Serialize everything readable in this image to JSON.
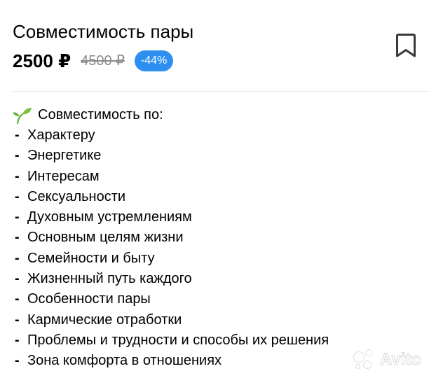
{
  "listing": {
    "title": "Совместимость пары",
    "price": "2500 ₽",
    "old_price": "4500 ₽",
    "discount": "-44%",
    "bookmark_icon": "bookmark-icon"
  },
  "description": {
    "heading_icon": "sprout-icon",
    "heading": "Совместимость по:",
    "items": [
      "Характеру",
      "Энергетике",
      "Интересам",
      "Сексуальности",
      "Духовным устремлениям",
      "Основным целям жизни",
      "Семейности и быту",
      "Жизненный путь каждого",
      "Особенности пары",
      "Кармические отработки",
      "Проблемы и трудности и способы их решения",
      "Зона комфорта в отношениях"
    ],
    "dash": "-"
  },
  "watermark": {
    "text": "Avito"
  },
  "colors": {
    "discount_badge": "#2d8ff0",
    "old_price": "#8a8a8a",
    "icon": "#3a3a3a",
    "divider": "#e6e6e6"
  }
}
